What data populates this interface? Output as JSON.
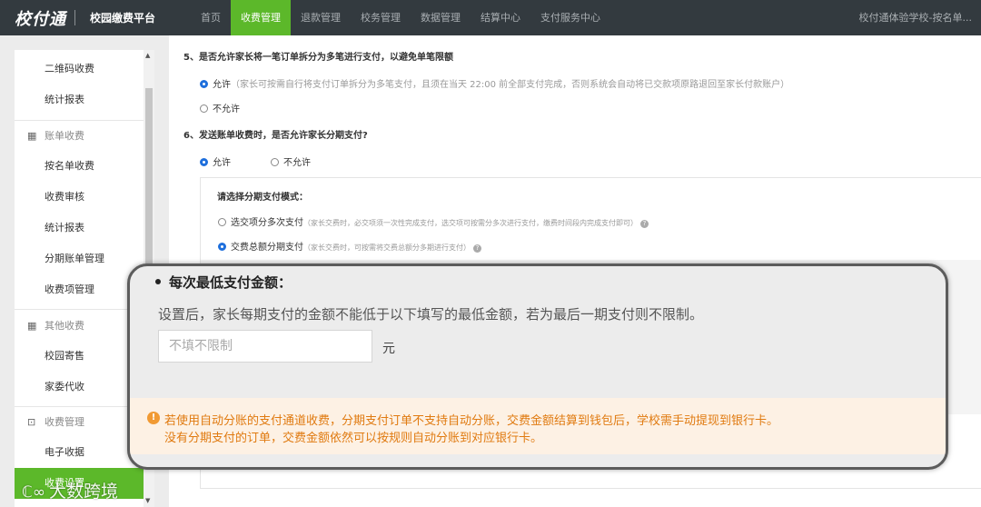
{
  "header": {
    "logo": "校付通",
    "platform": "校园缴费平台",
    "nav": [
      "首页",
      "收费管理",
      "退款管理",
      "校务管理",
      "数据管理",
      "结算中心",
      "支付服务中心"
    ],
    "active_nav": 1,
    "user": "校付通体验学校-按名单..."
  },
  "sidebar": {
    "items": [
      {
        "label": "二维码收费",
        "type": "item"
      },
      {
        "label": "统计报表",
        "type": "item"
      },
      {
        "label": "账单收费",
        "type": "group",
        "icon": "grid-icon"
      },
      {
        "label": "按名单收费",
        "type": "item"
      },
      {
        "label": "收费审核",
        "type": "item"
      },
      {
        "label": "统计报表",
        "type": "item"
      },
      {
        "label": "分期账单管理",
        "type": "item"
      },
      {
        "label": "收费项管理",
        "type": "item"
      },
      {
        "label": "其他收费",
        "type": "group",
        "icon": "grid-icon"
      },
      {
        "label": "校园寄售",
        "type": "item"
      },
      {
        "label": "家委代收",
        "type": "item"
      },
      {
        "label": "收费管理",
        "type": "group",
        "icon": "download-box-icon"
      },
      {
        "label": "电子收据",
        "type": "item"
      },
      {
        "label": "收费设置",
        "type": "item",
        "active": true
      }
    ]
  },
  "main": {
    "q5": {
      "title": "5、是否允许家长将一笔订单拆分为多笔进行支付，以避免单笔限额",
      "allow": "允许",
      "allow_hint": "（家长可按需自行将支付订单拆分为多笔支付，且须在当天 22:00 前全部支付完成，否则系统会自动将已交款项原路退回至家长付款账户）",
      "deny": "不允许"
    },
    "q6": {
      "title": "6、发送账单收费时，是否允许家长分期支付?",
      "allow": "允许",
      "deny": "不允许"
    },
    "mode": {
      "title": "请选择分期支付模式：",
      "opt1": "选交项分多次支付",
      "opt1_hint": "（家长交费时，必交项须一次性完成支付，选交项可按需分多次进行支付，缴费时间段内完成支付即可）",
      "opt2": "交费总额分期支付",
      "opt2_hint": "（家长交费时，可按需将交费总额分多期进行支付）"
    }
  },
  "callout": {
    "title": "每次最低支付金额：",
    "desc": "设置后，家长每期支付的金额不能低于以下填写的最低金额，若为最后一期支付则不限制。",
    "input_placeholder": "不填不限制",
    "unit": "元",
    "warning_line1": "若使用自动分账的支付通道收费，分期支付订单不支持自动分账，交费金额结算到钱包后，学校需手动提现到银行卡。",
    "warning_line2": "没有分期支付的订单，交费金额依然可以按规则自动分账到对应银行卡。"
  },
  "watermark": "大数跨境",
  "colors": {
    "nav_bg": "#333a3f",
    "accent": "#5cb82a",
    "radio": "#1e6fdc",
    "warning": "#e07a10"
  }
}
